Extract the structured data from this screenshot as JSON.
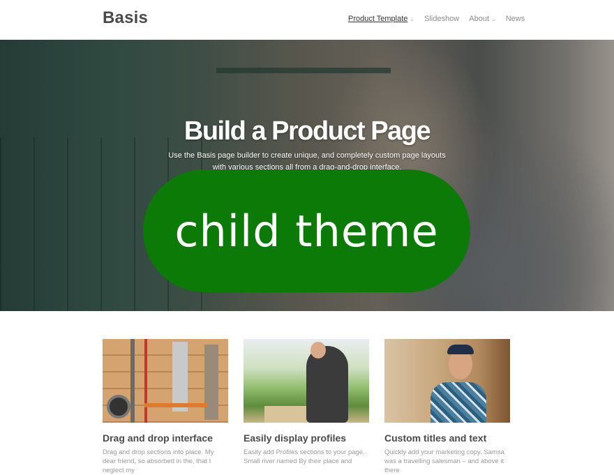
{
  "header": {
    "logo": "Basis",
    "nav": [
      {
        "label": "Product Template",
        "has_submenu": true,
        "active": true
      },
      {
        "label": "Slideshow",
        "has_submenu": false,
        "active": false
      },
      {
        "label": "About",
        "has_submenu": true,
        "active": false
      },
      {
        "label": "News",
        "has_submenu": false,
        "active": false
      }
    ],
    "caret": "⌄"
  },
  "hero": {
    "title": "Build a Product Page",
    "subtitle": "Use the Basis page builder to create unique, and completely custom page layouts with various sections all from a drag-and-drop interface.",
    "badge_text": "child theme",
    "badge_color": "#0b7a07"
  },
  "features": [
    {
      "title": "Drag and drop interface",
      "text": "Drag and drop sections into place. My dear friend, so absorbed in the, that I neglect my"
    },
    {
      "title": "Easily display profiles",
      "text": "Easily add Profiles sections to your page. Small river named By their place and"
    },
    {
      "title": "Custom titles and text",
      "text": "Quickly add your marketing copy. Samsa was a travelling salesman – and above it there"
    }
  ]
}
